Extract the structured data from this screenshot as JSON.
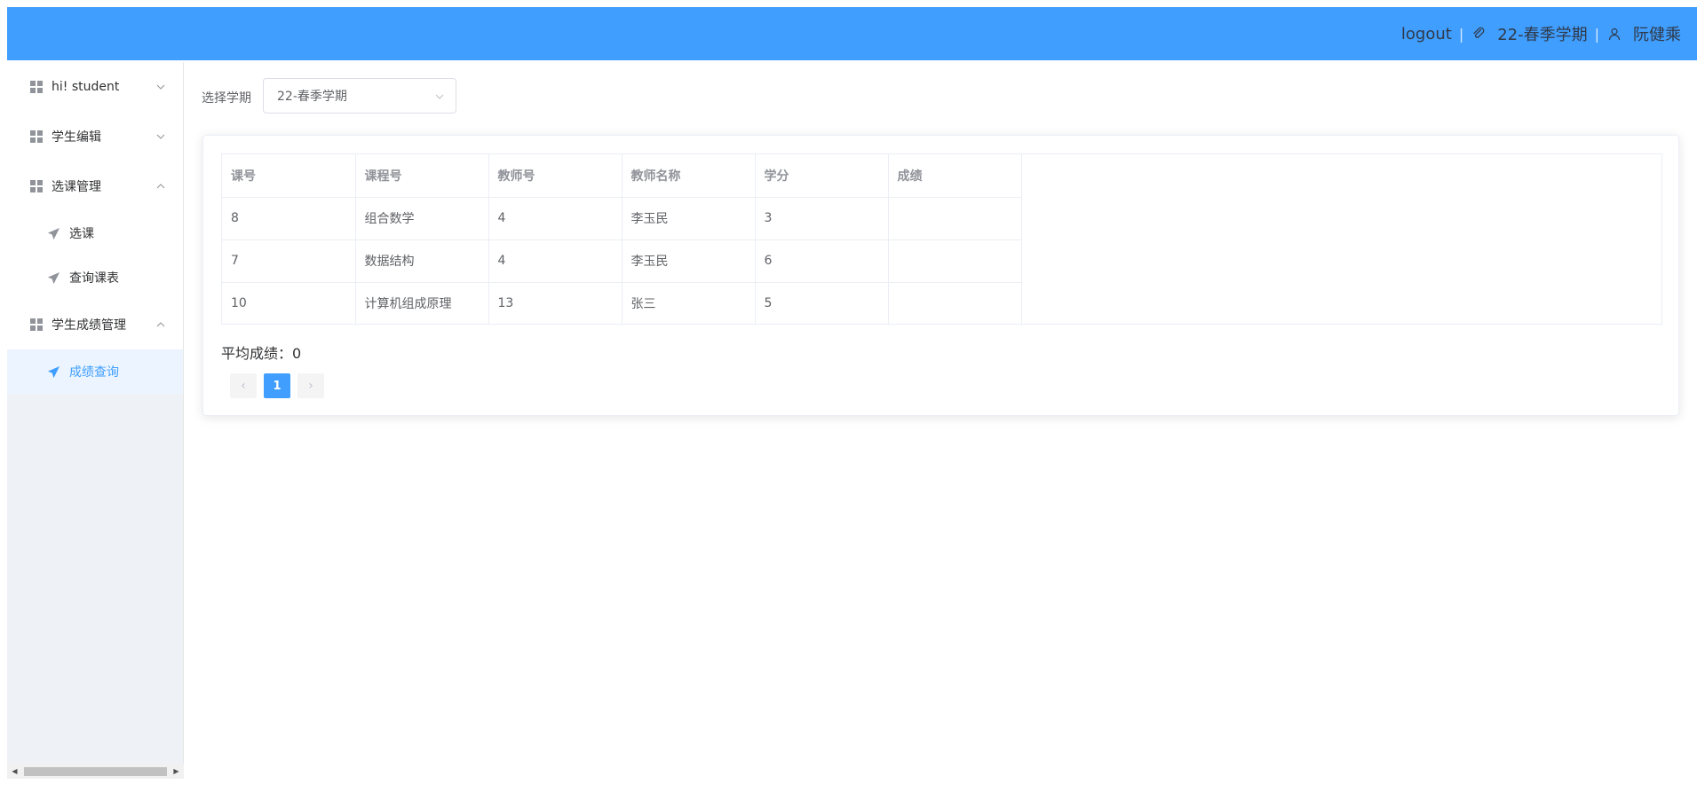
{
  "header": {
    "logout_label": "logout",
    "term_label": "22-春季学期",
    "user_name": "阮健乘",
    "separator": "|",
    "icons": [
      "paperclip-icon",
      "user-icon"
    ],
    "bg_color": "#409eff"
  },
  "sidebar": {
    "menus": [
      {
        "label": "hi! student",
        "expanded": false
      },
      {
        "label": "学生编辑",
        "expanded": false
      },
      {
        "label": "选课管理",
        "expanded": true,
        "children": [
          "选课",
          "查询课表"
        ]
      },
      {
        "label": "学生成绩管理",
        "expanded": true,
        "children": [
          "成绩查询"
        ]
      }
    ],
    "active_item": "成绩查询",
    "active_color": "#409eff"
  },
  "main": {
    "term_select_label": "选择学期",
    "term_select_value": "22-春季学期",
    "table": {
      "headers": [
        "课号",
        "课程号",
        "教师号",
        "教师名称",
        "学分",
        "成绩"
      ],
      "rows": [
        [
          "8",
          "组合数学",
          "4",
          "李玉民",
          "3",
          ""
        ],
        [
          "7",
          "数据结构",
          "4",
          "李玉民",
          "6",
          ""
        ],
        [
          "10",
          "计算机组成原理",
          "13",
          "张三",
          "5",
          ""
        ]
      ]
    },
    "average_label": "平均成绩：0",
    "pagination": {
      "prev": "‹",
      "current_page": "1",
      "next": "›"
    }
  }
}
